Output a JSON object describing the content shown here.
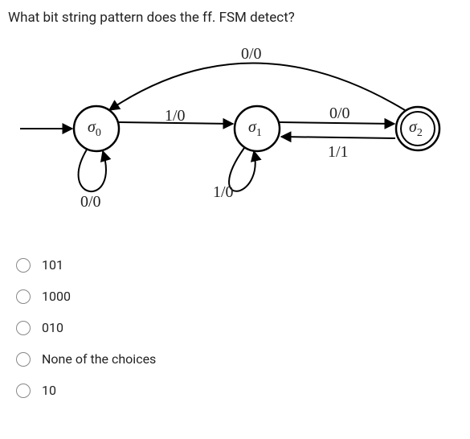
{
  "question": "What bit string pattern does the ff. FSM detect?",
  "states": {
    "s0": "σ",
    "s0_sub": "0",
    "s1": "σ",
    "s1_sub": "1",
    "s2": "σ",
    "s2_sub": "2"
  },
  "edges": {
    "top_back": "0/0",
    "s0_to_s1": "1/0",
    "s1_to_s2": "0/0",
    "s2_to_s1": "1/1",
    "s0_loop": "0/0",
    "s1_loop": "1/0"
  },
  "options": [
    "101",
    "1000",
    "010",
    "None of the choices",
    "10"
  ]
}
